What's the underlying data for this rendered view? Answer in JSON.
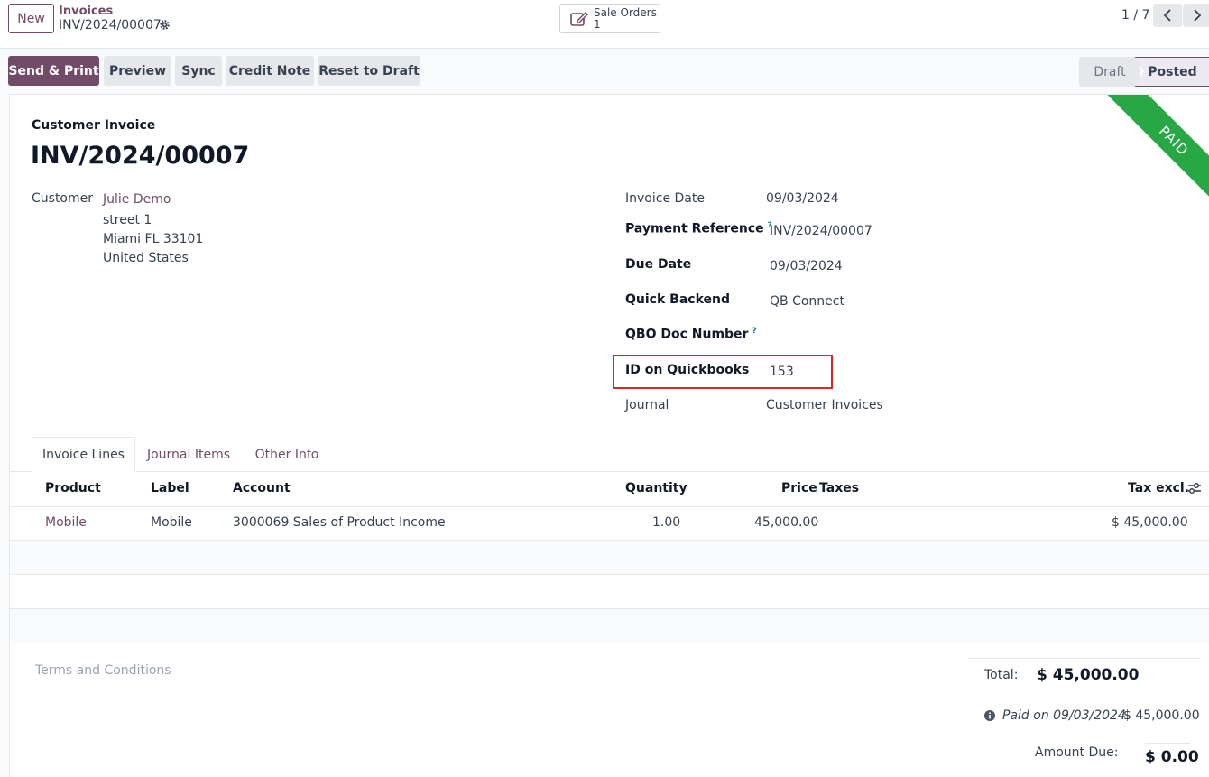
{
  "topbar": {
    "new_label": "New",
    "breadcrumb_parent": "Invoices",
    "breadcrumb_current": "INV/2024/00007",
    "smart_button": {
      "title": "Sale Orders",
      "count": "1"
    },
    "pager": "1 / 7"
  },
  "actions": {
    "send_print": "Send & Print",
    "preview": "Preview",
    "sync": "Sync",
    "credit_note": "Credit Note",
    "reset_draft": "Reset to Draft"
  },
  "statusbar": {
    "draft": "Draft",
    "posted": "Posted"
  },
  "ribbon": "PAID",
  "invoice": {
    "type": "Customer Invoice",
    "number": "INV/2024/00007",
    "customer_label": "Customer",
    "customer_name": "Julie Demo",
    "address_line1": "street 1",
    "address_line2": "Miami FL 33101",
    "address_line3": "United States"
  },
  "fields": {
    "invoice_date_label": "Invoice Date",
    "invoice_date": "09/03/2024",
    "payment_ref_label": "Payment Reference",
    "payment_ref": "INV/2024/00007",
    "due_date_label": "Due Date",
    "due_date": "09/03/2024",
    "quick_backend_label": "Quick Backend",
    "quick_backend": "QB Connect",
    "qbo_doc_label": "QBO Doc Number",
    "qb_id_label": "ID on Quickbooks",
    "qb_id": "153",
    "journal_label": "Journal",
    "journal": "Customer Invoices",
    "help_mark": "?"
  },
  "tabs": [
    "Invoice Lines",
    "Journal Items",
    "Other Info"
  ],
  "table": {
    "headers": {
      "product": "Product",
      "label": "Label",
      "account": "Account",
      "quantity": "Quantity",
      "price": "Price",
      "taxes": "Taxes",
      "tax_excl": "Tax excl."
    },
    "rows": [
      {
        "product": "Mobile",
        "label": "Mobile",
        "account": "3000069 Sales of Product Income",
        "quantity": "1.00",
        "price": "45,000.00",
        "taxes": "",
        "subtotal": "$ 45,000.00"
      }
    ]
  },
  "footer": {
    "terms_placeholder": "Terms and Conditions",
    "total_label": "Total:",
    "total": "$ 45,000.00",
    "paid_on": "Paid on 09/03/2024",
    "paid_amount": "$ 45,000.00",
    "amount_due_label": "Amount Due:",
    "amount_due": "$ 0.00"
  }
}
